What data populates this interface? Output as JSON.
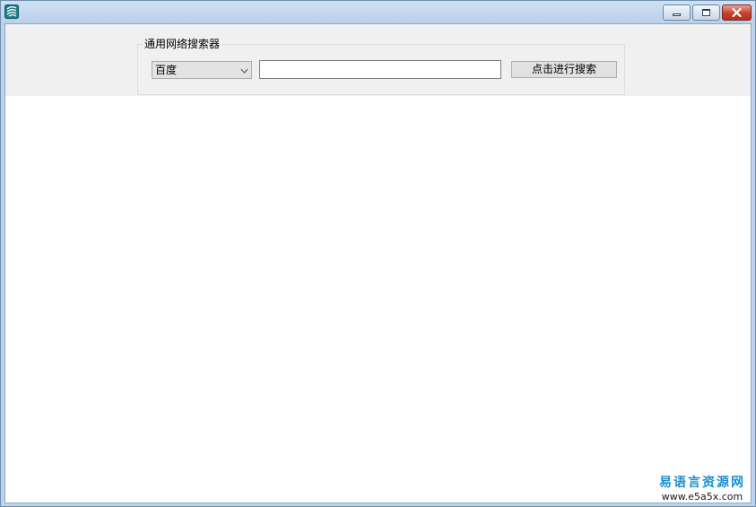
{
  "window": {
    "title": "",
    "controls": {
      "minimize": "minimize-icon",
      "maximize": "maximize-icon",
      "close": "close-icon"
    },
    "colors": {
      "titlebar": "#bdd3ec",
      "close_button": "#c7402d",
      "client_background": "#ffffff",
      "panel_background": "#f0f0f0"
    }
  },
  "search_panel": {
    "group_title": "通用网络搜索器",
    "engine_selected": "百度",
    "query_value": "",
    "query_placeholder": "",
    "search_button_label": "点击进行搜索"
  },
  "watermark": {
    "site_name": "易语言资源网",
    "url": "www.e5a5x.com",
    "color": "#1b8fd2"
  }
}
